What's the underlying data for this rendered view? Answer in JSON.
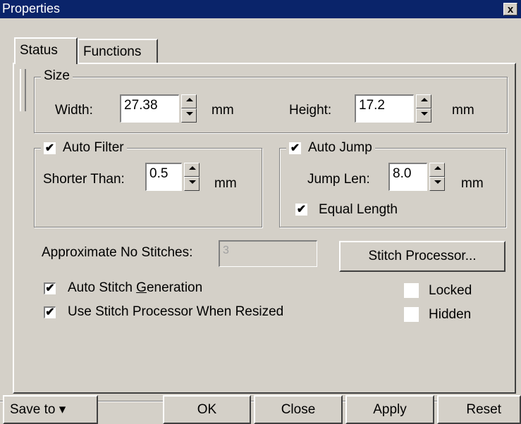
{
  "window": {
    "title": "Properties",
    "close_glyph": "x"
  },
  "tabs": [
    {
      "label": "Status"
    },
    {
      "label": "Functions"
    }
  ],
  "size_group": {
    "legend": "Size",
    "width_label": "Width:",
    "width_value": "27.38",
    "width_unit": "mm",
    "height_label": "Height:",
    "height_value": "17.2",
    "height_unit": "mm"
  },
  "auto_filter": {
    "legend": "Auto Filter",
    "checked": true,
    "check_glyph": "✔",
    "shorter_label": "Shorter Than:",
    "shorter_value": "0.5",
    "unit": "mm"
  },
  "auto_jump": {
    "legend": "Auto Jump",
    "checked": true,
    "check_glyph": "✔",
    "jump_label": "Jump Len:",
    "jump_value": "8.0",
    "unit": "mm",
    "equal_length_label": "Equal Length",
    "equal_length_glyph": "✔"
  },
  "stitches": {
    "label": "Approximate No Stitches:",
    "value": "3",
    "processor_button": "Stitch Processor..."
  },
  "options": {
    "auto_gen_prefix": "Auto Stitch ",
    "auto_gen_accel": "G",
    "auto_gen_suffix": "eneration",
    "auto_gen_glyph": "✔",
    "use_processor_label": "Use Stitch Processor When Resized",
    "use_processor_glyph": "✔",
    "locked_label": "Locked",
    "hidden_label": "Hidden"
  },
  "buttons": {
    "save_to": "Save to",
    "save_to_arrow": "▾",
    "ok": "OK",
    "close": "Close",
    "apply": "Apply",
    "reset": "Reset"
  },
  "colors": {
    "titlebar": "#0a246a",
    "face": "#d4d0c8"
  }
}
